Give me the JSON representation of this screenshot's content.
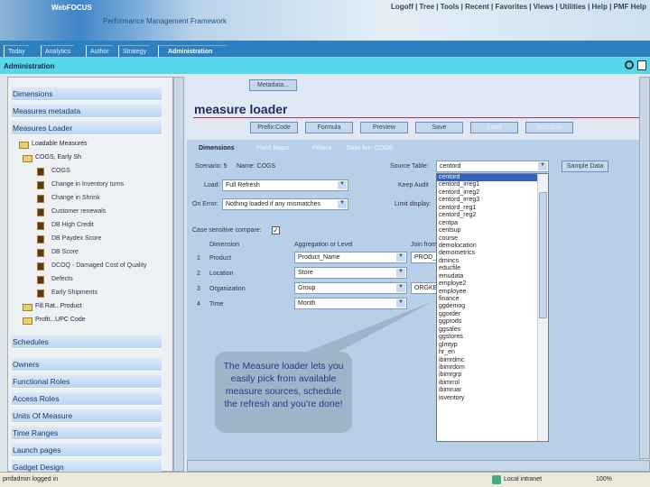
{
  "header": {
    "brand": "WebFOCUS",
    "subtitle": "Performance Management Framework",
    "links": "Logoff | Tree | Tools | Recent | Favorites | Views | Utilities | Help | PMF Help"
  },
  "tabs": [
    "Today",
    "Analytics",
    "Author",
    "Strategy",
    "Administration"
  ],
  "admin_bar": {
    "title": "Administration"
  },
  "left": {
    "sections_top": [
      "Dimensions",
      "Measures metadata",
      "Measures Loader"
    ],
    "tree": {
      "root": "Loadable Measures",
      "group": "COGS, Early Sh",
      "items": [
        "COGS",
        "Change in Inventory turns",
        "Change in Shrink",
        "Customer renewals",
        "DB High Credit",
        "DB Paydex Score",
        "DB Score",
        "DCOQ - Damaged Cost of Quality",
        "Defects",
        "Early Shipments"
      ],
      "folders": [
        "Fill Rat...Product",
        "Profit...UPC Code"
      ]
    },
    "sections_bottom": [
      "Schedules",
      "Owners",
      "Functional Roles",
      "Access Roles",
      "Units Of Measure",
      "Time Ranges",
      "Launch pages",
      "Gadget Design"
    ]
  },
  "main": {
    "metadata_button": "Metadata...",
    "title": "measure loader",
    "buttons": [
      "Prefix:Code",
      "Formula",
      "Preview",
      "Save",
      "Load",
      "Schedule"
    ],
    "subtabs": [
      "Dimensions",
      "Field Maps",
      "Filters",
      "Data for: COGS"
    ],
    "scenario_label": "Scenario: 5",
    "name_label": "Name: COGS",
    "source_table_label": "Source Table:",
    "source_table_value": "centord",
    "sample_data_button": "Sample Data",
    "load_label": "Load:",
    "load_value": "Full Refresh",
    "keep_audit_label": "Keep Audit",
    "on_error_label": "On Error:",
    "on_error_value": "Nothing loaded if any mismatches",
    "limit_display_label": "Limit display:",
    "case_label": "Case sensitive compare:",
    "case_checked": true,
    "columns": [
      "Dimension",
      "Aggregation or Level",
      "Join from"
    ],
    "rows": [
      {
        "n": "1",
        "dim": "Product",
        "agg": "Product_Name",
        "join": "PROD_"
      },
      {
        "n": "2",
        "dim": "Location",
        "agg": "Store",
        "join": ""
      },
      {
        "n": "3",
        "dim": "Organization",
        "agg": "Group",
        "join": "ORGKE"
      },
      {
        "n": "4",
        "dim": "Time",
        "agg": "Month",
        "join": ""
      }
    ],
    "dropdown_options": [
      "centord",
      "centord_irreg1",
      "centord_irreg2",
      "centord_irreg3",
      "centord_reg1",
      "centord_reg2",
      "centpa",
      "centsup",
      "course",
      "demolocation",
      "demometrics",
      "dmincs",
      "educfile",
      "emudata",
      "employe2",
      "employee",
      "finance",
      "ggdemog",
      "ggorder",
      "ggprods",
      "ggsales",
      "ggstores",
      "glmtyp",
      "hr_en",
      "ibimrdmc",
      "ibimrdom",
      "ibimrgrp",
      "ibimrrol",
      "ibimruar",
      "inventory"
    ],
    "callout": "The Measure loader lets you easily pick from available measure sources, schedule the refresh and you're done!"
  },
  "status": {
    "text": "pmfadmin logged in",
    "zone": "Local intranet",
    "zoom": "100%"
  }
}
